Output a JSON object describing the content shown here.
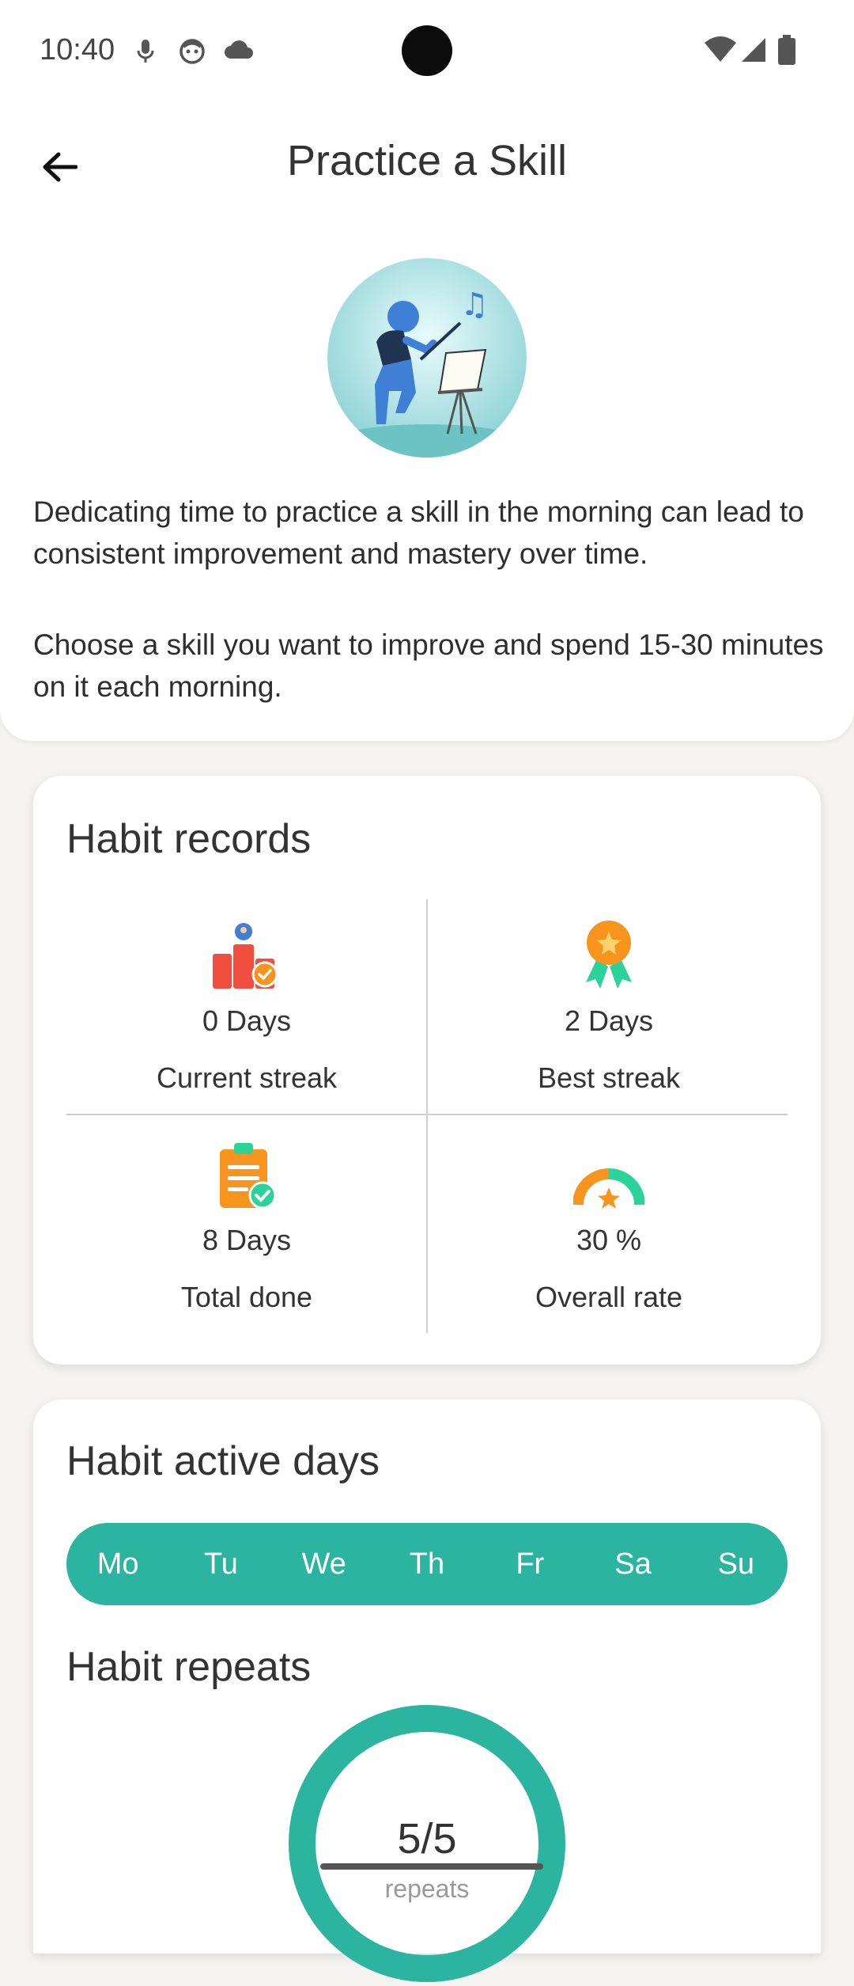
{
  "status_bar": {
    "time": "10:40",
    "left_icons": [
      "mic-icon",
      "face-icon",
      "cloud-icon"
    ],
    "right_icons": [
      "wifi-icon",
      "signal-icon",
      "battery-icon"
    ]
  },
  "header": {
    "title": "Practice a Skill",
    "back_icon": "arrow-left-icon"
  },
  "description": [
    "Dedicating time to practice a skill in the morning can lead to consistent improvement and mastery over time.",
    "Choose a skill you want to improve and spend 15-30 minutes on it each morning."
  ],
  "records": {
    "title": "Habit records",
    "items": [
      {
        "value": "0 Days",
        "label": "Current streak",
        "icon": "podium-icon"
      },
      {
        "value": "2 Days",
        "label": "Best streak",
        "icon": "medal-icon"
      },
      {
        "value": "8 Days",
        "label": "Total done",
        "icon": "clipboard-check-icon"
      },
      {
        "value": "30 %",
        "label": "Overall rate",
        "icon": "gauge-star-icon"
      }
    ]
  },
  "active_days": {
    "title": "Habit active days",
    "days": [
      "Mo",
      "Tu",
      "We",
      "Th",
      "Fr",
      "Sa",
      "Su"
    ]
  },
  "repeats": {
    "title": "Habit repeats",
    "value": "5/5",
    "label": "repeats",
    "progress": 1.0
  },
  "colors": {
    "accent": "#2bb5a0",
    "card": "#ffffff",
    "background": "#f4f3f1",
    "orange": "#f7941d",
    "red": "#f04e3e"
  }
}
